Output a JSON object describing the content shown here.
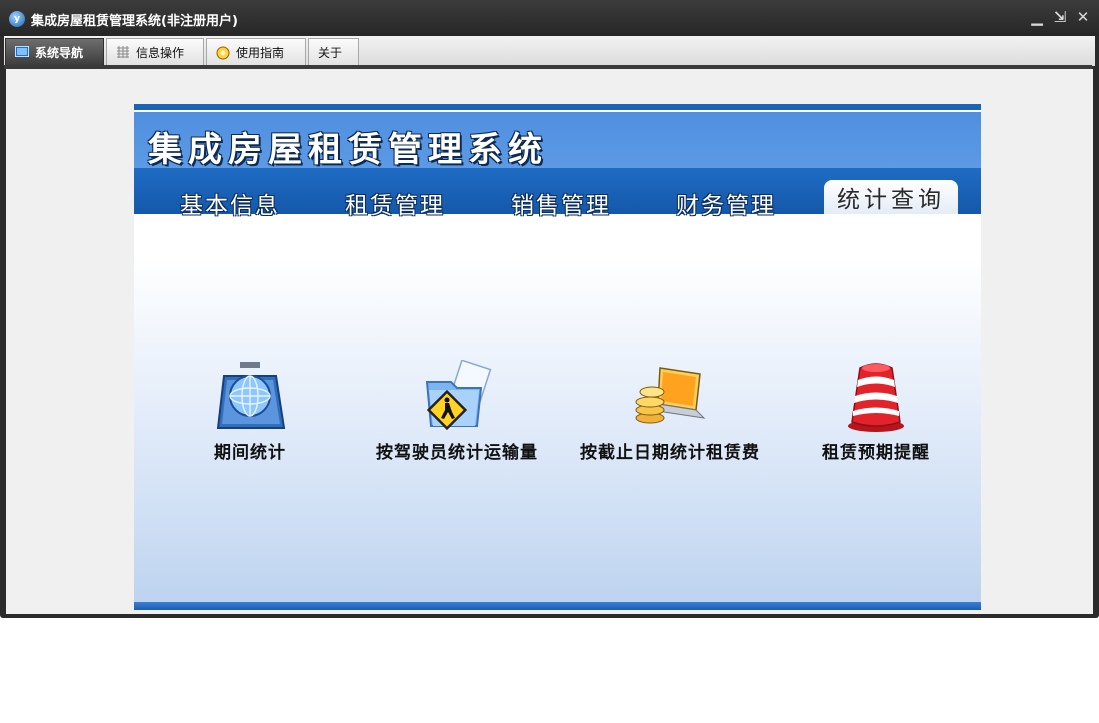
{
  "window": {
    "title": "集成房屋租赁管理系统(非注册用户)",
    "app_icon": "y"
  },
  "window_controls": {
    "minimize": "▁",
    "restore": "⇲",
    "close": "✕"
  },
  "tabs": [
    {
      "label": "系统导航",
      "icon": "monitor-icon",
      "active": true
    },
    {
      "label": "信息操作",
      "icon": "grid-icon",
      "active": false
    },
    {
      "label": "使用指南",
      "icon": "guide-icon",
      "active": false
    },
    {
      "label": "关于",
      "icon": "",
      "active": false
    }
  ],
  "panel": {
    "system_title": "集成房屋租赁管理系统",
    "nav": [
      {
        "label": "基本信息",
        "active": false
      },
      {
        "label": "租赁管理",
        "active": false
      },
      {
        "label": "销售管理",
        "active": false
      },
      {
        "label": "财务管理",
        "active": false
      },
      {
        "label": "统计查询",
        "active": true
      }
    ],
    "functions": [
      {
        "label": "期间统计",
        "icon": "globe-icon"
      },
      {
        "label": "按驾驶员统计运输量",
        "icon": "pedestrian-folder-icon"
      },
      {
        "label": "按截止日期统计租赁费",
        "icon": "coins-laptop-icon"
      },
      {
        "label": "租赁预期提醒",
        "icon": "alarm-bell-icon"
      }
    ]
  },
  "colors": {
    "accent": "#1b63b6",
    "header": "#5c9ae5",
    "window": "#2b2b2b"
  }
}
